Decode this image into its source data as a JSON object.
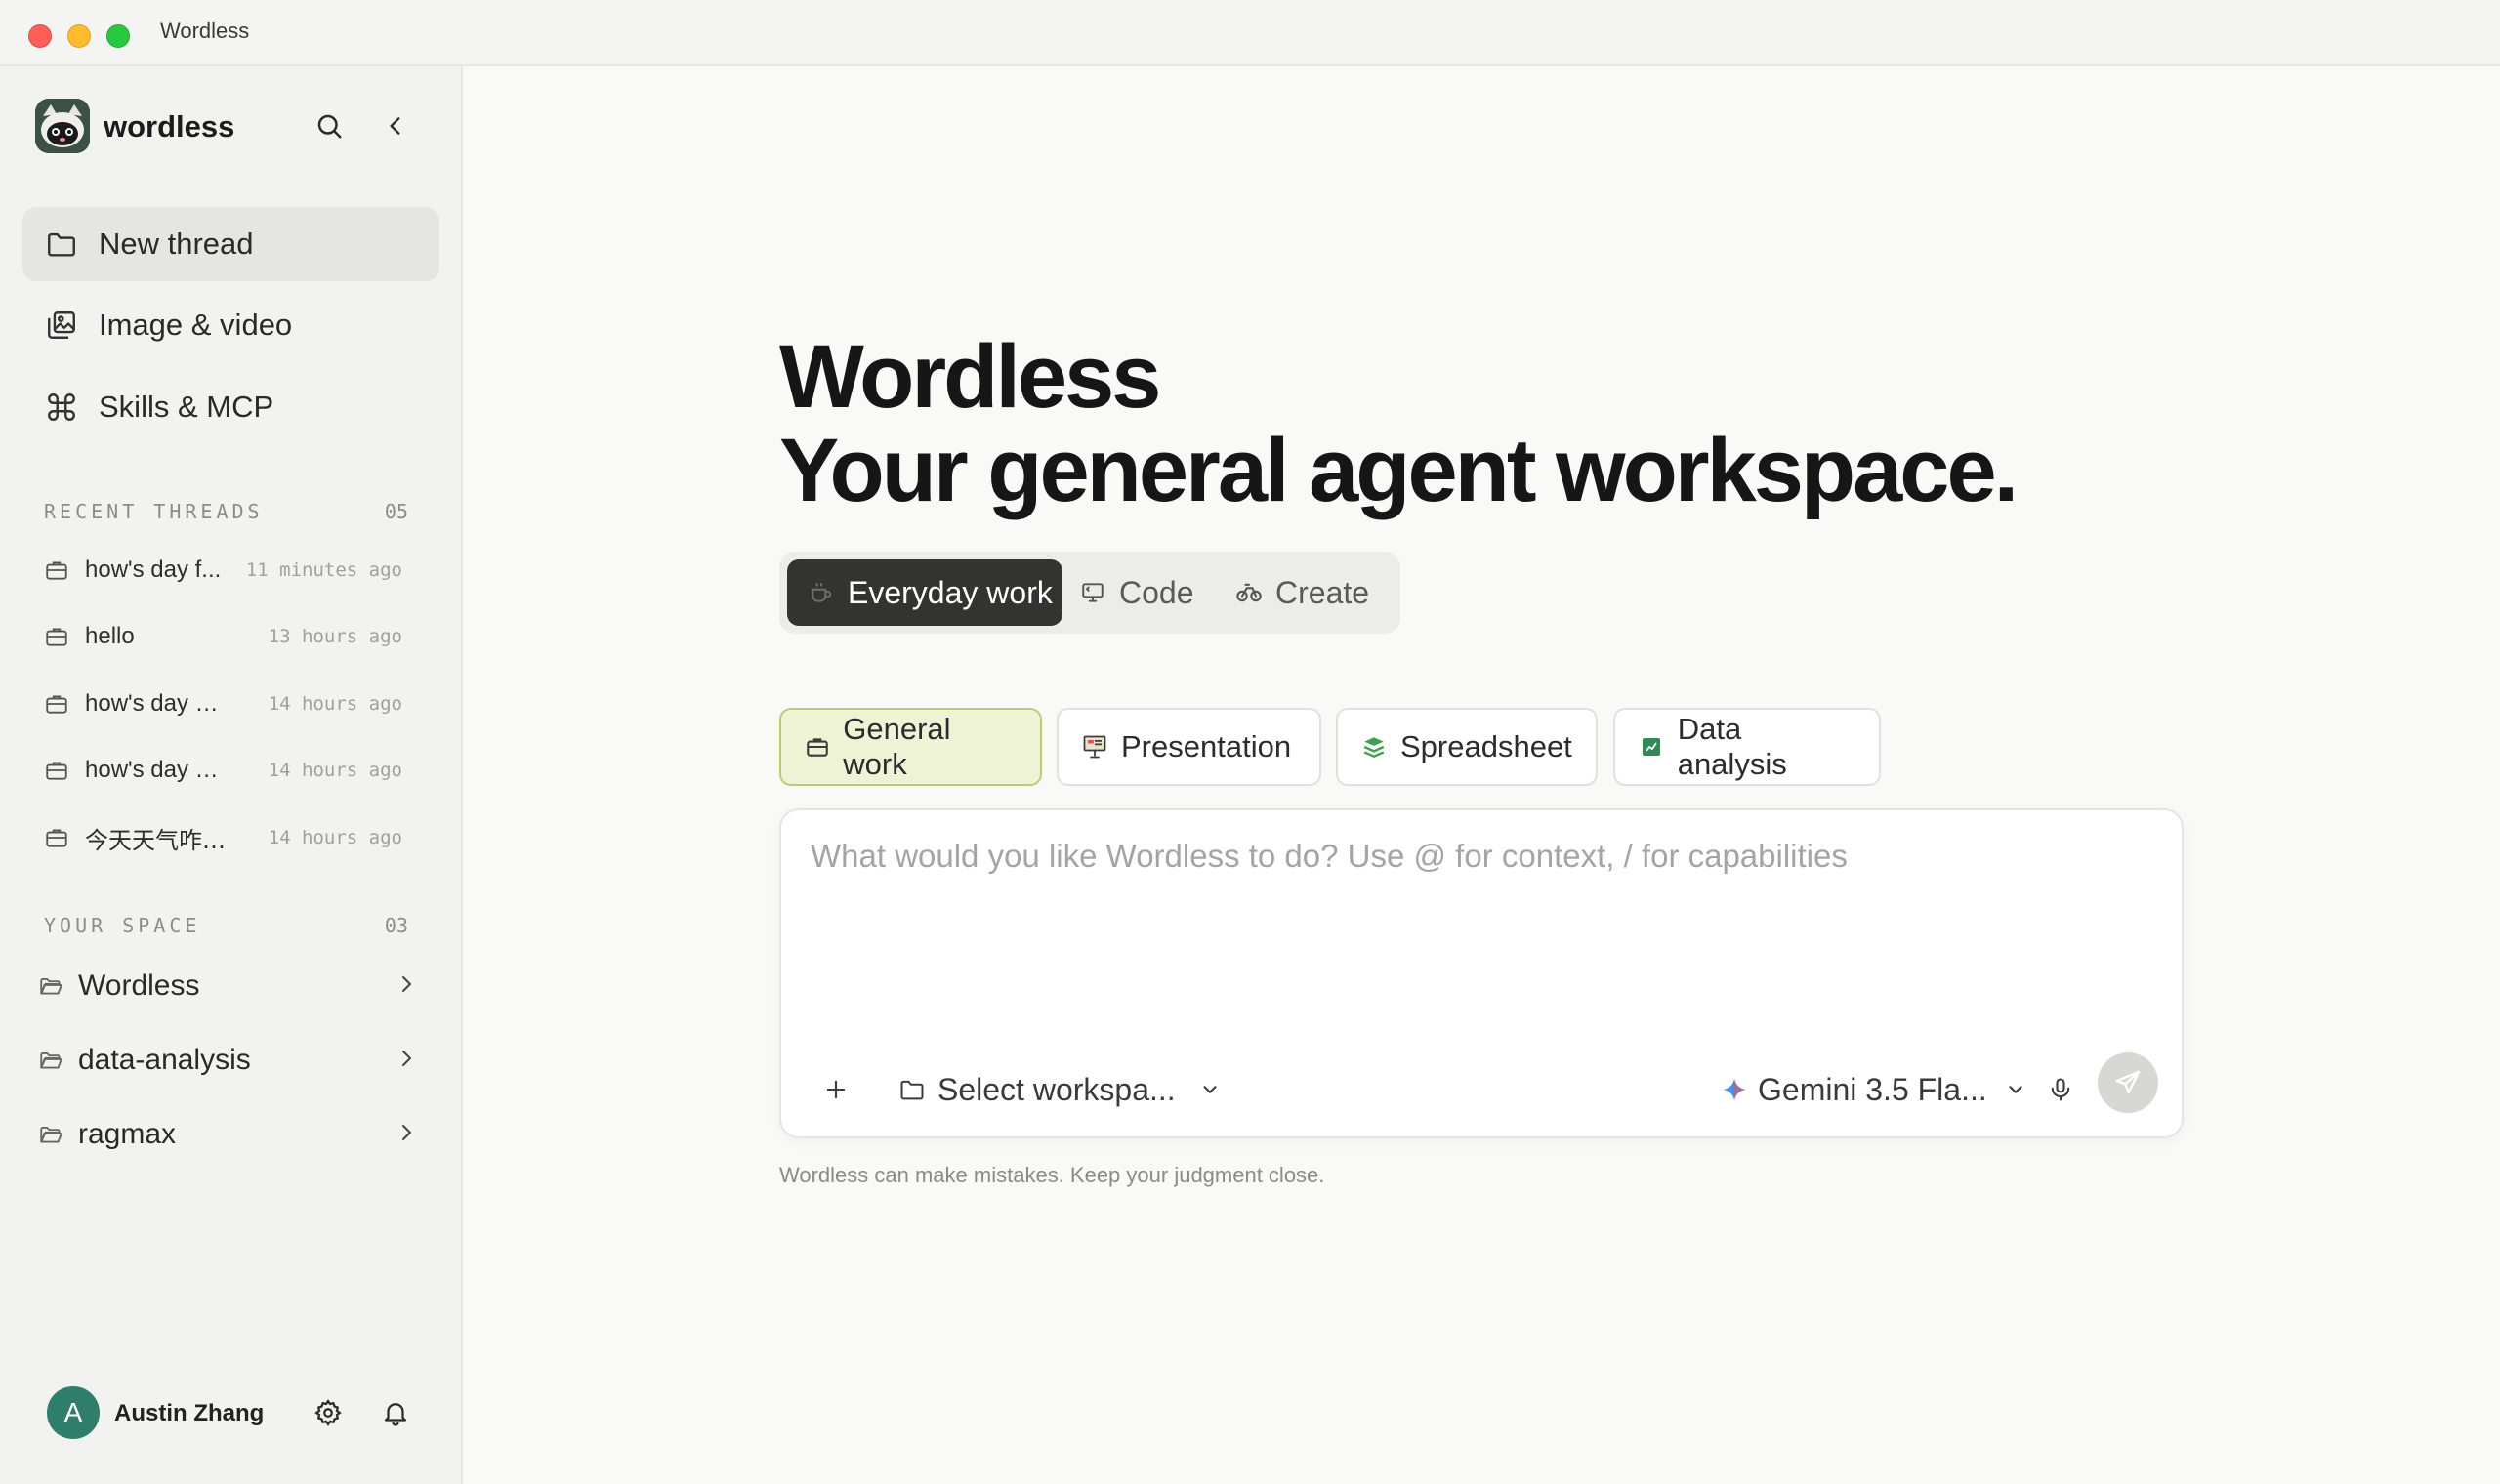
{
  "window": {
    "title": "Wordless"
  },
  "sidebar": {
    "brand": "wordless",
    "nav": [
      {
        "label": "New thread",
        "icon": "folder-icon",
        "active": true
      },
      {
        "label": "Image & video",
        "icon": "image-video-icon",
        "active": false
      },
      {
        "label": "Skills & MCP",
        "icon": "command-icon",
        "active": false
      }
    ],
    "recent_threads": {
      "label": "RECENT THREADS",
      "count": "05",
      "items": [
        {
          "title": "how's day f...",
          "time": "11 minutes ago"
        },
        {
          "title": "hello",
          "time": "13 hours ago"
        },
        {
          "title": "how's day goi...",
          "time": "14 hours ago"
        },
        {
          "title": "how's day goi...",
          "time": "14 hours ago"
        },
        {
          "title": "今天天气咋样...",
          "time": "14 hours ago"
        }
      ]
    },
    "your_space": {
      "label": "YOUR SPACE",
      "count": "03",
      "items": [
        {
          "name": "Wordless"
        },
        {
          "name": "data-analysis"
        },
        {
          "name": "ragmax"
        }
      ]
    },
    "user": {
      "initial": "A",
      "name": "Austin Zhang",
      "avatar_color": "#2f7e6b"
    }
  },
  "main": {
    "title_line1": "Wordless",
    "title_line2": "Your general agent workspace.",
    "mode_tabs": [
      {
        "label": "Everyday work",
        "active": true
      },
      {
        "label": "Code",
        "active": false
      },
      {
        "label": "Create",
        "active": false
      }
    ],
    "chips": [
      {
        "label": "General work",
        "active": true
      },
      {
        "label": "Presentation",
        "active": false
      },
      {
        "label": "Spreadsheet",
        "active": false
      },
      {
        "label": "Data analysis",
        "active": false
      }
    ],
    "composer": {
      "placeholder": "What would you like Wordless to do? Use @ for context, / for capabilities",
      "workspace_select": "Select workspa...",
      "model_select": "Gemini 3.5 Fla..."
    },
    "disclaimer": "Wordless can make mistakes. Keep your judgment close."
  },
  "colors": {
    "active_nav_bg": "#e5e5e1",
    "active_mode_tab_bg": "#333332",
    "active_chip_bg": "#eef3d6",
    "active_chip_border": "#b7cd74",
    "send_button_bg": "#d7d7d4"
  }
}
